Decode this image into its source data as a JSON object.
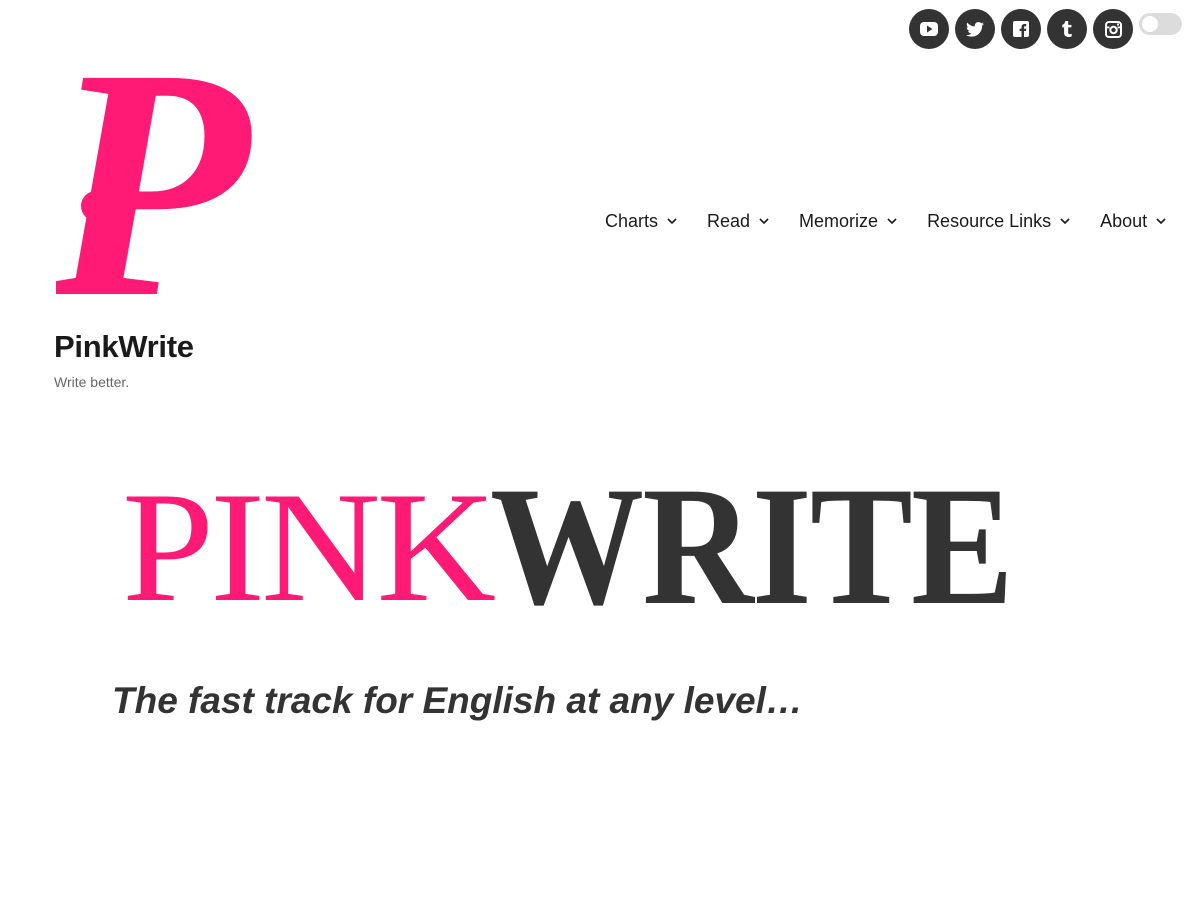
{
  "header": {
    "site_title": "PinkWrite",
    "tagline": "Write better."
  },
  "logo": {
    "letter": "P",
    "color": "#ff1a75"
  },
  "social": [
    {
      "name": "youtube-icon"
    },
    {
      "name": "twitter-icon"
    },
    {
      "name": "facebook-icon"
    },
    {
      "name": "tumblr-icon"
    },
    {
      "name": "instagram-icon"
    }
  ],
  "theme_toggle": {
    "state": "off"
  },
  "nav": {
    "items": [
      {
        "label": "Charts"
      },
      {
        "label": "Read"
      },
      {
        "label": "Memorize"
      },
      {
        "label": "Resource Links"
      },
      {
        "label": "About"
      }
    ]
  },
  "banner": {
    "pink_part": "PINK",
    "dark_part": "WRITE",
    "pink_color": "#ff1a75",
    "dark_color": "#333333"
  },
  "hero": {
    "tagline": "The fast track for English at any level…"
  }
}
